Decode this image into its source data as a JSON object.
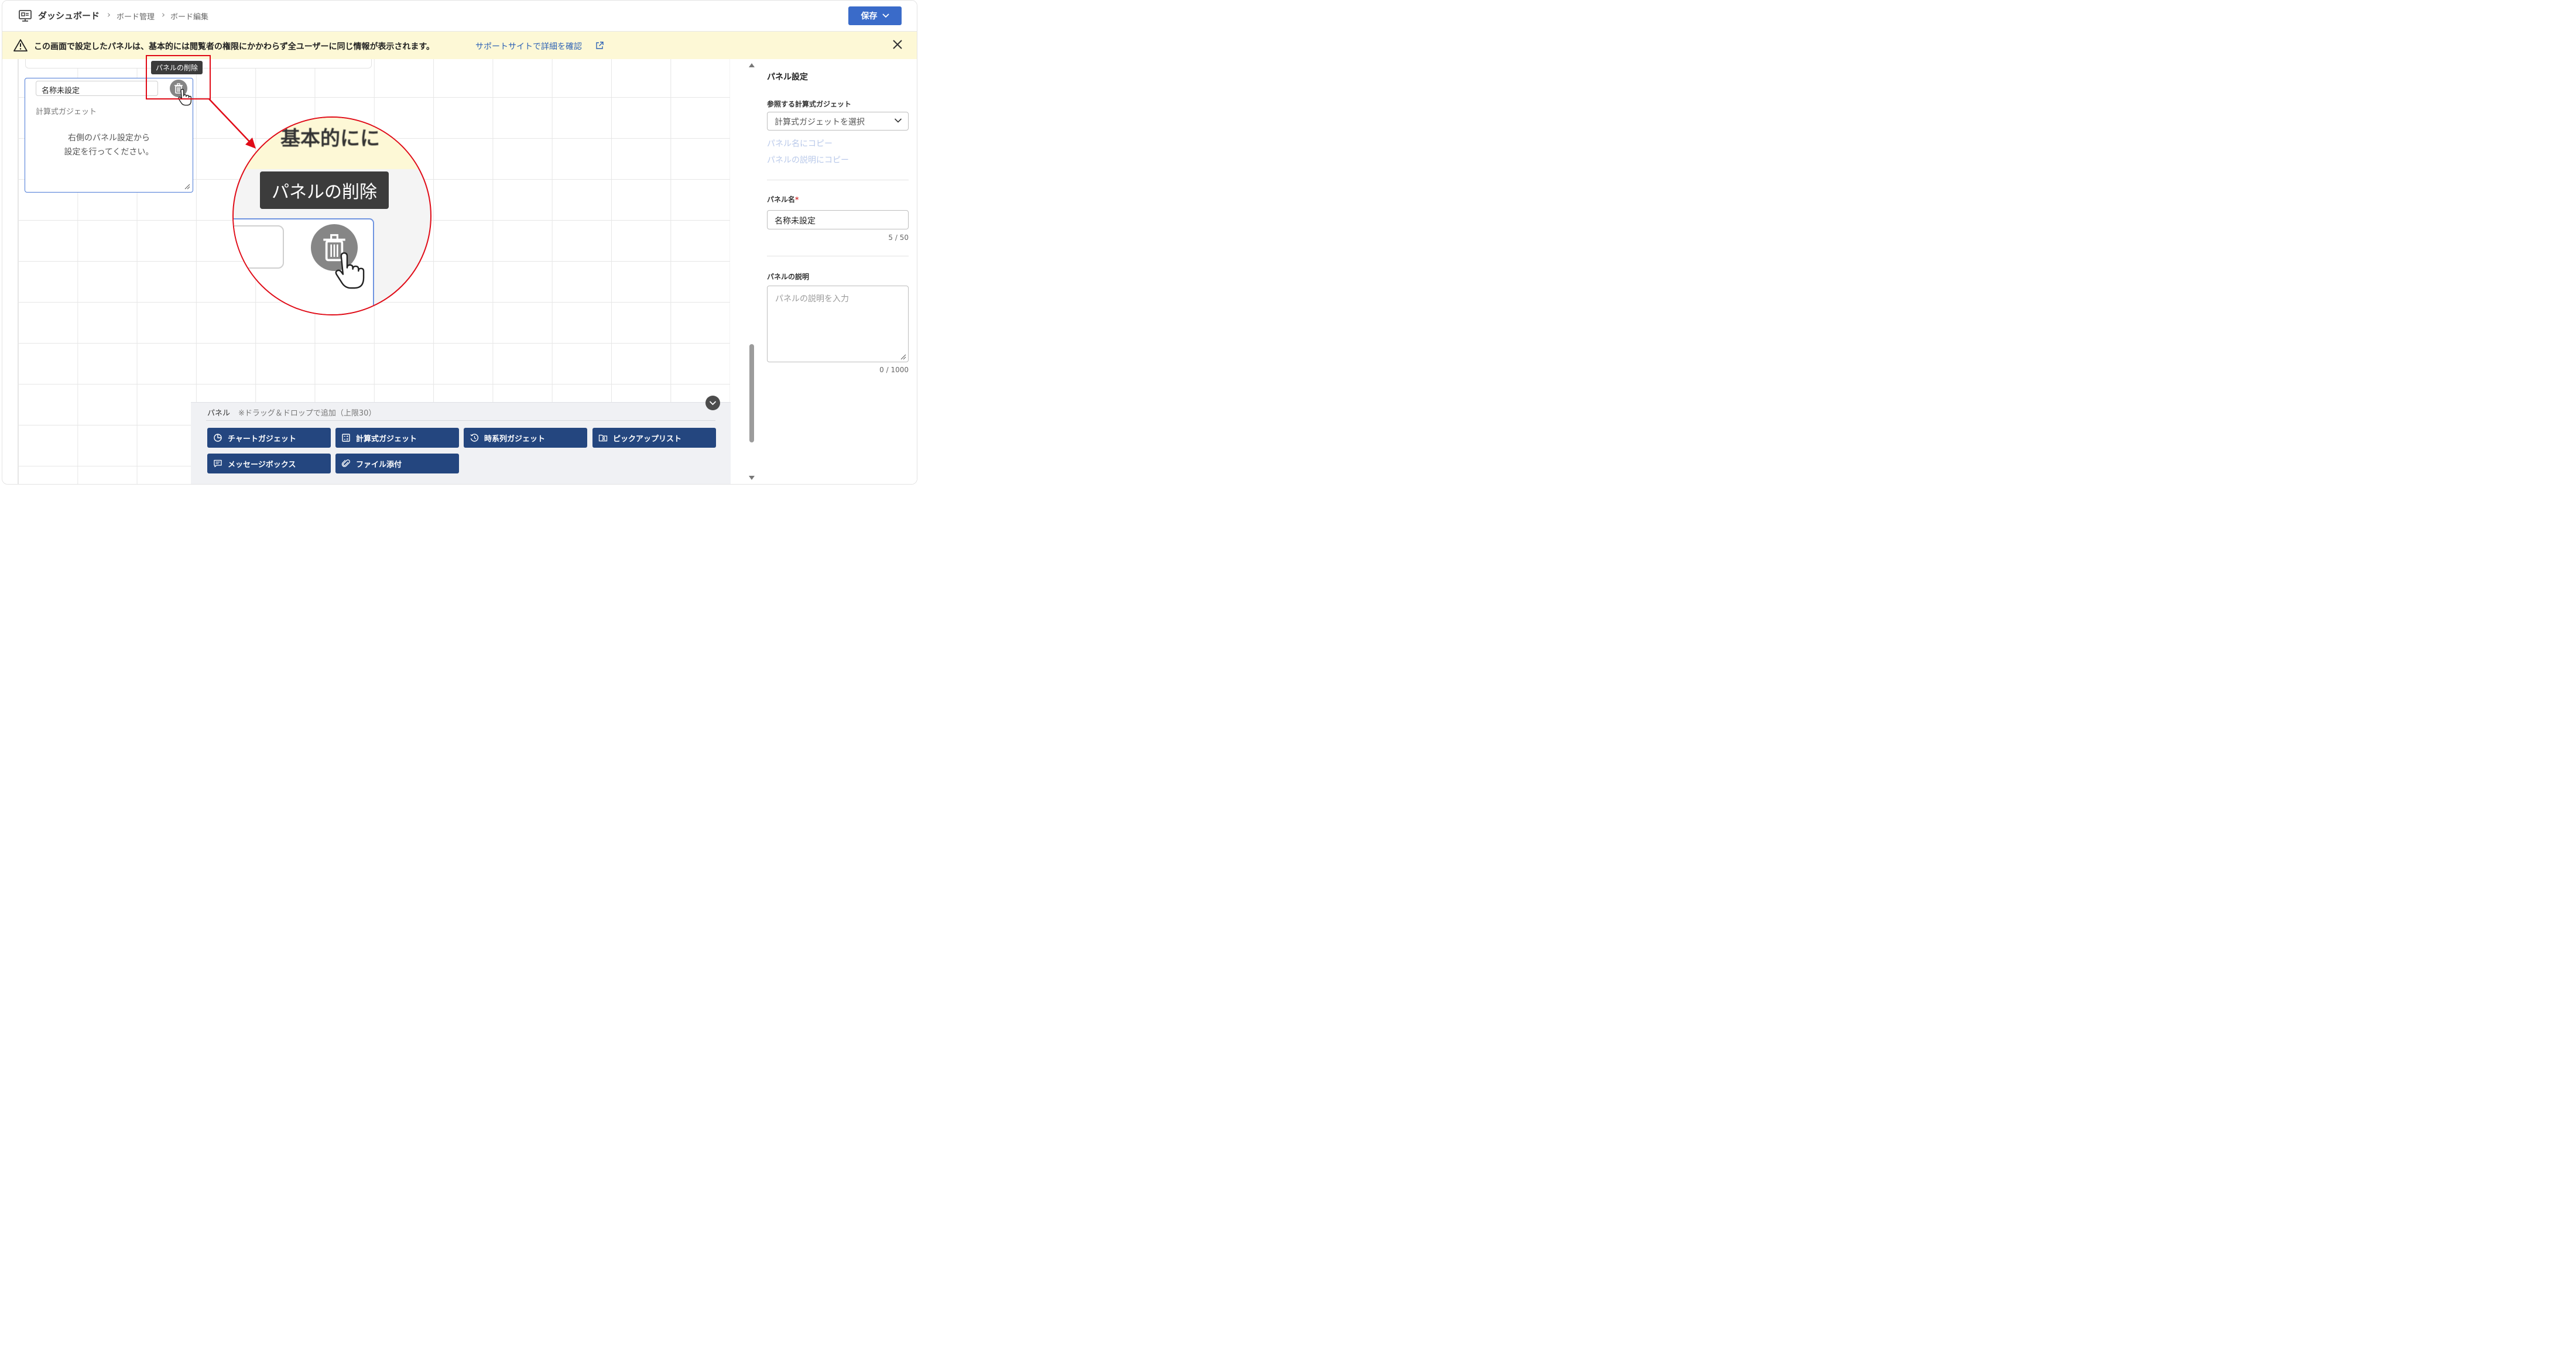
{
  "header": {
    "breadcrumb": [
      "ダッシュボード",
      "ボード管理",
      "ボード編集"
    ],
    "save_label": "保存"
  },
  "notice": {
    "text": "この画面で設定したパネルは、基本的には閲覧者の権限にかかわらず全ユーザーに同じ情報が表示されます。",
    "link": "サポートサイトで詳細を確認"
  },
  "panel": {
    "name": "名称未設定",
    "kind": "計算式ガジェット",
    "empty_line1": "右側のパネル設定から",
    "empty_line2": "設定を行ってください。",
    "delete_tooltip": "パネルの削除"
  },
  "zoom": {
    "banner_text": "基本的にに",
    "tooltip": "パネルの削除"
  },
  "palette": {
    "title": "パネル",
    "note": "※ドラッグ＆ドロップで追加（上限30）",
    "buttons": [
      {
        "label": "チャートガジェット",
        "icon": "pie-chart-icon"
      },
      {
        "label": "計算式ガジェット",
        "icon": "calculator-icon"
      },
      {
        "label": "時系列ガジェット",
        "icon": "history-icon"
      },
      {
        "label": "ピックアップリスト",
        "icon": "folder-person-icon"
      },
      {
        "label": "メッセージボックス",
        "icon": "message-icon"
      },
      {
        "label": "ファイル添付",
        "icon": "paperclip-icon"
      }
    ]
  },
  "side": {
    "title": "パネル設定",
    "gadget_label": "参照する計算式ガジェット",
    "gadget_placeholder": "計算式ガジェットを選択",
    "copy_to_name": "パネル名にコピー",
    "copy_to_desc": "パネルの説明にコピー",
    "name_label": "パネル名",
    "required_mark": "*",
    "name_value": "名称未設定",
    "name_counter": "5 / 50",
    "desc_label": "パネルの説明",
    "desc_placeholder": "パネルの説明を入力",
    "desc_counter": "0 / 1000"
  },
  "colors": {
    "accent": "#3a6bc9",
    "gadget_button": "#24467f",
    "notice_bg": "#fdf8d6",
    "annotation_red": "#e00b17"
  }
}
